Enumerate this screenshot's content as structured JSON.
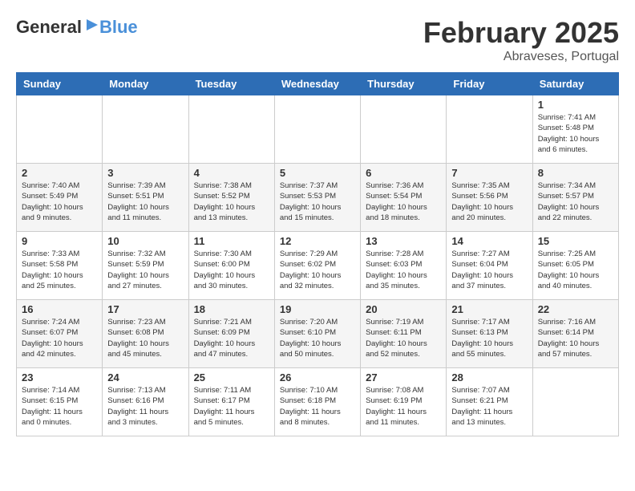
{
  "header": {
    "logo": {
      "text_general": "General",
      "text_blue": "Blue"
    },
    "title": "February 2025",
    "location": "Abraveses, Portugal"
  },
  "days_of_week": [
    "Sunday",
    "Monday",
    "Tuesday",
    "Wednesday",
    "Thursday",
    "Friday",
    "Saturday"
  ],
  "weeks": [
    [
      {
        "day": "",
        "info": ""
      },
      {
        "day": "",
        "info": ""
      },
      {
        "day": "",
        "info": ""
      },
      {
        "day": "",
        "info": ""
      },
      {
        "day": "",
        "info": ""
      },
      {
        "day": "",
        "info": ""
      },
      {
        "day": "1",
        "info": "Sunrise: 7:41 AM\nSunset: 5:48 PM\nDaylight: 10 hours\nand 6 minutes."
      }
    ],
    [
      {
        "day": "2",
        "info": "Sunrise: 7:40 AM\nSunset: 5:49 PM\nDaylight: 10 hours\nand 9 minutes."
      },
      {
        "day": "3",
        "info": "Sunrise: 7:39 AM\nSunset: 5:51 PM\nDaylight: 10 hours\nand 11 minutes."
      },
      {
        "day": "4",
        "info": "Sunrise: 7:38 AM\nSunset: 5:52 PM\nDaylight: 10 hours\nand 13 minutes."
      },
      {
        "day": "5",
        "info": "Sunrise: 7:37 AM\nSunset: 5:53 PM\nDaylight: 10 hours\nand 15 minutes."
      },
      {
        "day": "6",
        "info": "Sunrise: 7:36 AM\nSunset: 5:54 PM\nDaylight: 10 hours\nand 18 minutes."
      },
      {
        "day": "7",
        "info": "Sunrise: 7:35 AM\nSunset: 5:56 PM\nDaylight: 10 hours\nand 20 minutes."
      },
      {
        "day": "8",
        "info": "Sunrise: 7:34 AM\nSunset: 5:57 PM\nDaylight: 10 hours\nand 22 minutes."
      }
    ],
    [
      {
        "day": "9",
        "info": "Sunrise: 7:33 AM\nSunset: 5:58 PM\nDaylight: 10 hours\nand 25 minutes."
      },
      {
        "day": "10",
        "info": "Sunrise: 7:32 AM\nSunset: 5:59 PM\nDaylight: 10 hours\nand 27 minutes."
      },
      {
        "day": "11",
        "info": "Sunrise: 7:30 AM\nSunset: 6:00 PM\nDaylight: 10 hours\nand 30 minutes."
      },
      {
        "day": "12",
        "info": "Sunrise: 7:29 AM\nSunset: 6:02 PM\nDaylight: 10 hours\nand 32 minutes."
      },
      {
        "day": "13",
        "info": "Sunrise: 7:28 AM\nSunset: 6:03 PM\nDaylight: 10 hours\nand 35 minutes."
      },
      {
        "day": "14",
        "info": "Sunrise: 7:27 AM\nSunset: 6:04 PM\nDaylight: 10 hours\nand 37 minutes."
      },
      {
        "day": "15",
        "info": "Sunrise: 7:25 AM\nSunset: 6:05 PM\nDaylight: 10 hours\nand 40 minutes."
      }
    ],
    [
      {
        "day": "16",
        "info": "Sunrise: 7:24 AM\nSunset: 6:07 PM\nDaylight: 10 hours\nand 42 minutes."
      },
      {
        "day": "17",
        "info": "Sunrise: 7:23 AM\nSunset: 6:08 PM\nDaylight: 10 hours\nand 45 minutes."
      },
      {
        "day": "18",
        "info": "Sunrise: 7:21 AM\nSunset: 6:09 PM\nDaylight: 10 hours\nand 47 minutes."
      },
      {
        "day": "19",
        "info": "Sunrise: 7:20 AM\nSunset: 6:10 PM\nDaylight: 10 hours\nand 50 minutes."
      },
      {
        "day": "20",
        "info": "Sunrise: 7:19 AM\nSunset: 6:11 PM\nDaylight: 10 hours\nand 52 minutes."
      },
      {
        "day": "21",
        "info": "Sunrise: 7:17 AM\nSunset: 6:13 PM\nDaylight: 10 hours\nand 55 minutes."
      },
      {
        "day": "22",
        "info": "Sunrise: 7:16 AM\nSunset: 6:14 PM\nDaylight: 10 hours\nand 57 minutes."
      }
    ],
    [
      {
        "day": "23",
        "info": "Sunrise: 7:14 AM\nSunset: 6:15 PM\nDaylight: 11 hours\nand 0 minutes."
      },
      {
        "day": "24",
        "info": "Sunrise: 7:13 AM\nSunset: 6:16 PM\nDaylight: 11 hours\nand 3 minutes."
      },
      {
        "day": "25",
        "info": "Sunrise: 7:11 AM\nSunset: 6:17 PM\nDaylight: 11 hours\nand 5 minutes."
      },
      {
        "day": "26",
        "info": "Sunrise: 7:10 AM\nSunset: 6:18 PM\nDaylight: 11 hours\nand 8 minutes."
      },
      {
        "day": "27",
        "info": "Sunrise: 7:08 AM\nSunset: 6:19 PM\nDaylight: 11 hours\nand 11 minutes."
      },
      {
        "day": "28",
        "info": "Sunrise: 7:07 AM\nSunset: 6:21 PM\nDaylight: 11 hours\nand 13 minutes."
      },
      {
        "day": "",
        "info": ""
      }
    ]
  ]
}
